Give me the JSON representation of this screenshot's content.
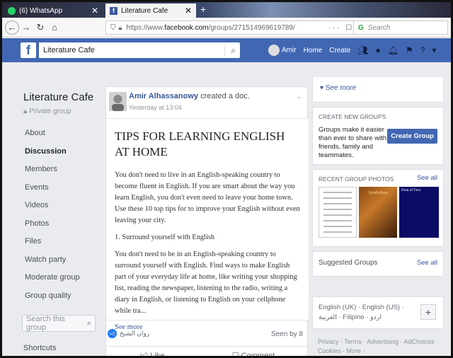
{
  "browser": {
    "tabs": [
      {
        "label": "(6) WhatsApp"
      },
      {
        "label": "Literature Cafe"
      }
    ],
    "url": {
      "prefix": "https://www.",
      "domain": "facebook.com",
      "path": "/groups/271514969619789/"
    },
    "url_actions": "··· ☐ ☆",
    "search_placeholder": "Search"
  },
  "facebook_bar": {
    "logo": "f",
    "search_value": "Literature Cafe",
    "user_name": "Amir",
    "links": [
      "Home",
      "Create"
    ]
  },
  "group": {
    "name": "Literature Cafe",
    "privacy": "Private group",
    "nav": [
      "About",
      "Discussion",
      "Members",
      "Events",
      "Videos",
      "Photos",
      "Files",
      "Watch party",
      "Moderate group",
      "Group quality"
    ],
    "active_nav": "Discussion",
    "search_placeholder": "Search this group",
    "shortcuts_label": "Shortcuts"
  },
  "post": {
    "author": "Amir Alhassanowy",
    "action": " created a doc.",
    "time": "Yesterday at 13:04",
    "doc_title": "TIPS FOR LEARNING ENGLISH AT HOME",
    "paragraphs": [
      "You don't need to live in an English-speaking country to become fluent in English. If you are smart about the way you learn English, you don't even need to leave your home town. Use these 10 top tips for to improve your English without even leaving your city.",
      "1. Surround yourself with English",
      "You don't need to be in an English-speaking country to surround yourself with English. Find ways to make English part of your everyday life at home, like writing your shopping list, reading the newspaper, listening to the radio, writing a diary in English, or listening to English on your cellphone while tra..."
    ],
    "see_more": "See more",
    "reactor": "روان الشيخ",
    "seen_by": "Seen by 8",
    "actions": [
      "Like",
      "Comment"
    ]
  },
  "right": {
    "see_more": "See more",
    "create_groups_title": "CREATE NEW GROUPS",
    "create_groups_text": "Groups make it easier than ever to share with friends, family and teammates.",
    "create_group_button": "Create Group",
    "photos_title": "RECENT GROUP PHOTOS",
    "photos_see_all": "See all",
    "photo2_caption": "Symbolism",
    "photo3_caption": "Point of View",
    "suggested_title": "Suggested Groups",
    "suggested_see_all": "See all",
    "languages": "English (UK) · English (US) · العربية · Filipino · اردو",
    "current_language": "English (US)",
    "footer": "Privacy · Terms · Advertising · AdChoices · Cookies · More ·"
  },
  "colors": {
    "facebook_blue": "#4267b2",
    "link": "#385898",
    "page_bg": "#e9ebee"
  }
}
